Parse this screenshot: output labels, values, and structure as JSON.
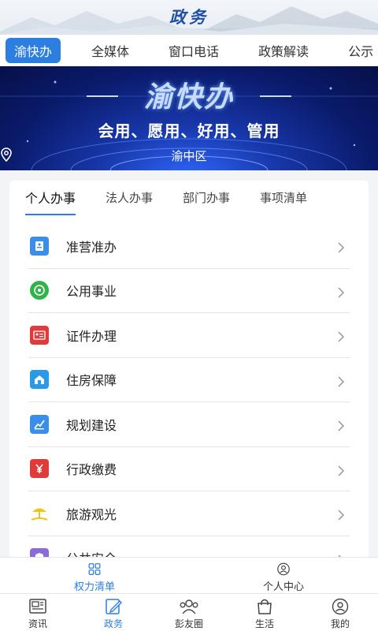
{
  "header": {
    "title": "政务"
  },
  "top_tabs": [
    {
      "label": "渝快办",
      "active": true
    },
    {
      "label": "全媒体",
      "active": false
    },
    {
      "label": "窗口电话",
      "active": false
    },
    {
      "label": "政策解读",
      "active": false
    },
    {
      "label": "公示",
      "active": false
    }
  ],
  "banner": {
    "title": "渝快办",
    "slogan": "会用、愿用、好用、管用",
    "location": "渝中区",
    "location_icon": "map-pin-icon"
  },
  "sub_tabs": [
    {
      "label": "个人办事",
      "active": true
    },
    {
      "label": "法人办事",
      "active": false
    },
    {
      "label": "部门办事",
      "active": false
    },
    {
      "label": "事项清单",
      "active": false
    }
  ],
  "services": [
    {
      "label": "准营准办",
      "icon": "license-icon",
      "color": "#3a8ee8"
    },
    {
      "label": "公用事业",
      "icon": "utility-icon",
      "color": "#2fb34a"
    },
    {
      "label": "证件办理",
      "icon": "id-card-icon",
      "color": "#e03b3b"
    },
    {
      "label": "住房保障",
      "icon": "house-icon",
      "color": "#2b9ae6"
    },
    {
      "label": "规划建设",
      "icon": "planning-icon",
      "color": "#3a8ee8"
    },
    {
      "label": "行政缴费",
      "icon": "payment-icon",
      "color": "#e03b3b"
    },
    {
      "label": "旅游观光",
      "icon": "beach-icon",
      "color": "#f1c21b"
    },
    {
      "label": "公共安全",
      "icon": "safety-icon",
      "color": "#8c6ad8"
    }
  ],
  "sub_nav": [
    {
      "label": "权力清单",
      "icon": "grid-icon",
      "active": true
    },
    {
      "label": "个人中心",
      "icon": "user-circle-icon",
      "active": false
    }
  ],
  "bottom_nav": [
    {
      "label": "资讯",
      "icon": "news-icon",
      "active": false
    },
    {
      "label": "政务",
      "icon": "edit-doc-icon",
      "active": true
    },
    {
      "label": "彭友圈",
      "icon": "friends-icon",
      "active": false
    },
    {
      "label": "生活",
      "icon": "bag-icon",
      "active": false
    },
    {
      "label": "我的",
      "icon": "profile-icon",
      "active": false
    }
  ],
  "colors": {
    "accent": "#2c7fe0",
    "title_blue": "#1f4fa6",
    "banner_dark": "#0a1a6a"
  }
}
